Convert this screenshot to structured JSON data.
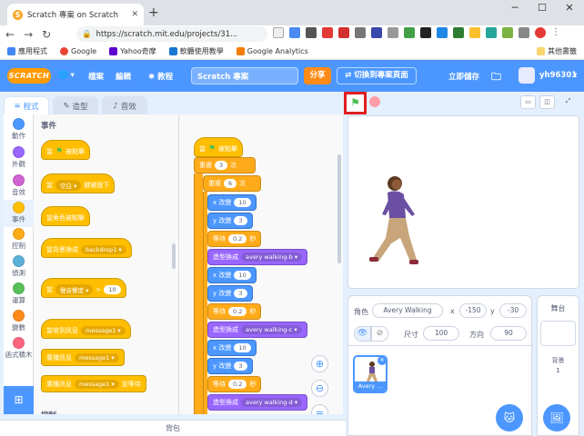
{
  "browser": {
    "tab_title": "Scratch 專案 on Scratch",
    "url": "https://scratch.mit.edu/projects/31...",
    "bookmarks": [
      "應用程式",
      "Google",
      "Yahoo奇摩",
      "軟體使用教學",
      "Google Analytics",
      "其他書籤"
    ]
  },
  "menu": {
    "logo": "SCRATCH",
    "file": "檔案",
    "edit": "編輯",
    "tutorials": "教程",
    "project_title": "Scratch 專案",
    "share": "分享",
    "see_project_page": "切換到專案頁面",
    "save_now": "立即儲存",
    "username": "yh96301"
  },
  "tabs": {
    "code": "程式",
    "costumes": "造型",
    "sounds": "音效"
  },
  "categories": [
    "動作",
    "外觀",
    "音效",
    "事件",
    "控制",
    "偵測",
    "運算",
    "變數",
    "函式積木"
  ],
  "palette": {
    "title": "事件",
    "when_flag": "當",
    "when_flag_suffix": "被點擊",
    "when_key": "當",
    "key_value": "空白",
    "key_suffix": "鍵被按下",
    "when_sprite_clicked": "當角色被點擊",
    "backdrop_when": "當背景換成",
    "backdrop_value": "backdrop1",
    "when_loudness": "當",
    "loudness_value": "聲音響度",
    "loudness_num": "10",
    "when_receive": "當收到訊息",
    "receive_value": "message1",
    "broadcast": "廣播訊息",
    "broadcast_value": "message1",
    "broadcast_wait": "廣播訊息",
    "broadcast_wait_value": "message1",
    "broadcast_wait_suffix": "並等待",
    "next_section": "控制"
  },
  "script": {
    "hat_prefix": "當",
    "hat_suffix": "被點擊",
    "repeat1_label": "重複",
    "repeat1_value": "3",
    "repeat1_suffix": "次",
    "repeat2_label": "重複",
    "repeat2_value": "6",
    "repeat2_suffix": "次",
    "change_x": "x 改變",
    "change_x_value": "10",
    "change_y": "y 改變",
    "change_y_value": "3",
    "wait": "等待",
    "wait_value": "0.2",
    "wait_suffix": "秒",
    "switch_costume": "造型換成",
    "costume_b": "avery walking-b",
    "costume_c": "avery walking-c",
    "costume_d": "avery walking-d"
  },
  "backpack": "背包",
  "sprite_info": {
    "sprite_label": "角色",
    "sprite_name": "Avery Walking",
    "x_label": "x",
    "x_value": "-150",
    "y_label": "y",
    "y_value": "-30",
    "show_label": "顯示",
    "size_label": "尺寸",
    "size_value": "100",
    "direction_label": "方向",
    "direction_value": "90"
  },
  "sprite_tile": "Avery ...",
  "stage_pane": {
    "title": "舞台",
    "backdrops_label": "背景",
    "backdrops_count": "1"
  }
}
